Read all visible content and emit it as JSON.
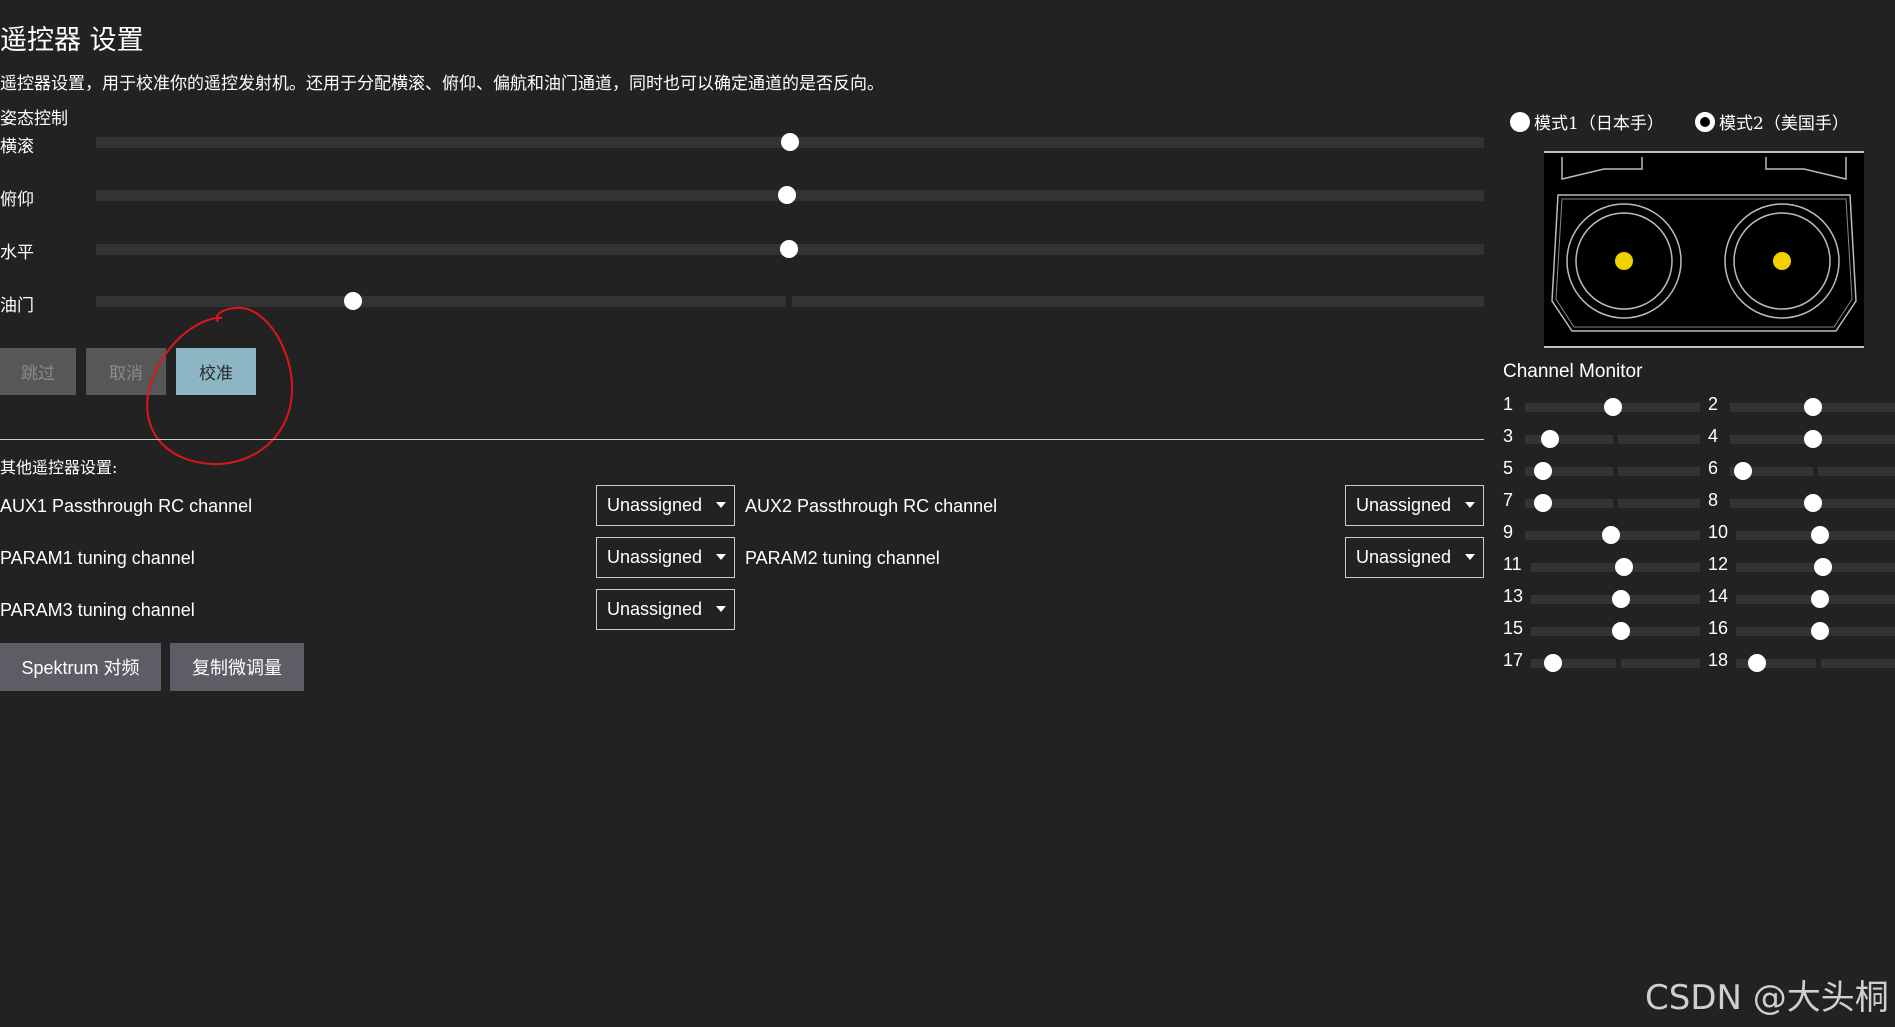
{
  "title": "遥控器 设置",
  "description": "遥控器设置，用于校准你的遥控发射机。还用于分配横滚、俯仰、偏航和油门通道，同时也可以确定通道的是否反向。",
  "attitude": {
    "section_label": "姿态控制",
    "axes": [
      {
        "label": "横滚",
        "value": 0.5
      },
      {
        "label": "俯仰",
        "value": 0.498
      },
      {
        "label": "水平",
        "value": 0.499
      },
      {
        "label": "油门",
        "value": 0.185
      }
    ]
  },
  "buttons": {
    "skip": "跳过",
    "cancel": "取消",
    "calibrate": "校准"
  },
  "other": {
    "label": "其他遥控器设置:",
    "aux1_label": "AUX1 Passthrough RC channel",
    "aux2_label": "AUX2 Passthrough RC channel",
    "param1_label": "PARAM1 tuning channel",
    "param2_label": "PARAM2 tuning channel",
    "param3_label": "PARAM3 tuning channel",
    "aux1_value": "Unassigned",
    "aux2_value": "Unassigned",
    "param1_value": "Unassigned",
    "param2_value": "Unassigned",
    "param3_value": "Unassigned"
  },
  "bottom_buttons": {
    "spektrum": "Spektrum 对频",
    "copy_trims": "复制微调量"
  },
  "modes": {
    "mode1": "模式1（日本手）",
    "mode2": "模式2（美国手）",
    "selected": "mode2"
  },
  "stick_colors": {
    "dot": "#f2d100"
  },
  "channel_monitor": {
    "title": "Channel Monitor",
    "channels": [
      {
        "num": "1",
        "value": 0.5
      },
      {
        "num": "2",
        "value": 0.5
      },
      {
        "num": "3",
        "value": 0.14
      },
      {
        "num": "4",
        "value": 0.5
      },
      {
        "num": "5",
        "value": 0.1
      },
      {
        "num": "6",
        "value": 0.08
      },
      {
        "num": "7",
        "value": 0.1
      },
      {
        "num": "8",
        "value": 0.5
      },
      {
        "num": "9",
        "value": 0.49
      },
      {
        "num": "10",
        "value": 0.53
      },
      {
        "num": "11",
        "value": 0.55
      },
      {
        "num": "12",
        "value": 0.55
      },
      {
        "num": "13",
        "value": 0.53
      },
      {
        "num": "14",
        "value": 0.53
      },
      {
        "num": "15",
        "value": 0.53
      },
      {
        "num": "16",
        "value": 0.53
      },
      {
        "num": "17",
        "value": 0.13
      },
      {
        "num": "18",
        "value": 0.13
      }
    ]
  },
  "watermark": "CSDN @大头桐"
}
